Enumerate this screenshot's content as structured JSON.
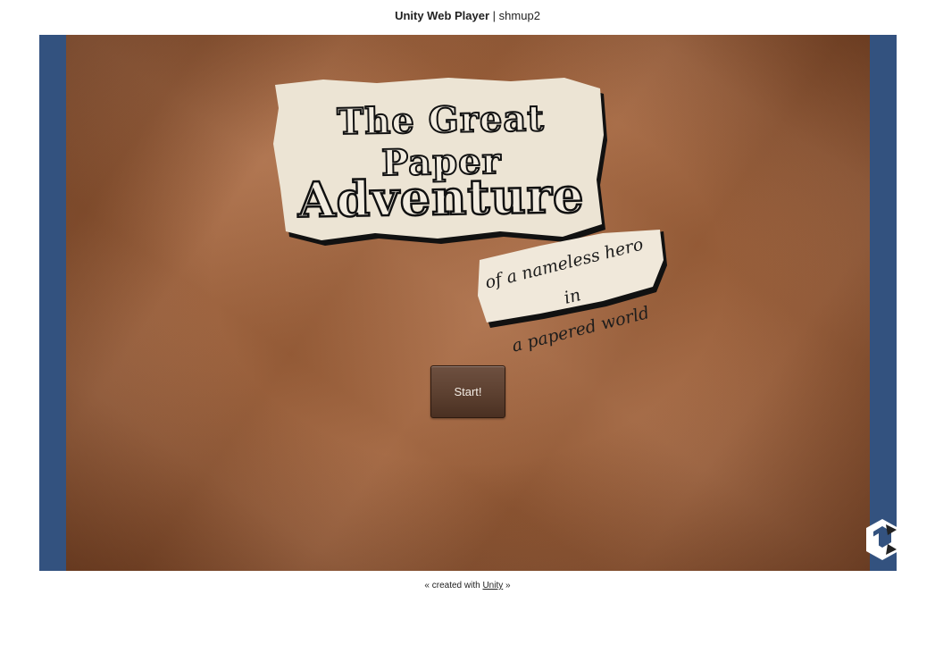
{
  "header": {
    "app_name": "Unity Web Player",
    "separator": "|",
    "game_name": "shmup2"
  },
  "game": {
    "title_line1": "The Great Paper",
    "title_line2": "Adventure",
    "subtitle_line1": "of a nameless hero in",
    "subtitle_line2": "a papered world",
    "start_label": "Start!"
  },
  "footer": {
    "prefix": "« created with",
    "link_label": "Unity",
    "suffix": "»"
  },
  "colors": {
    "player_background": "#33527f",
    "paper_background": "#a8673e",
    "button_background": "#5c4030"
  },
  "icons": {
    "unity_logo": "unity-logo-icon"
  }
}
